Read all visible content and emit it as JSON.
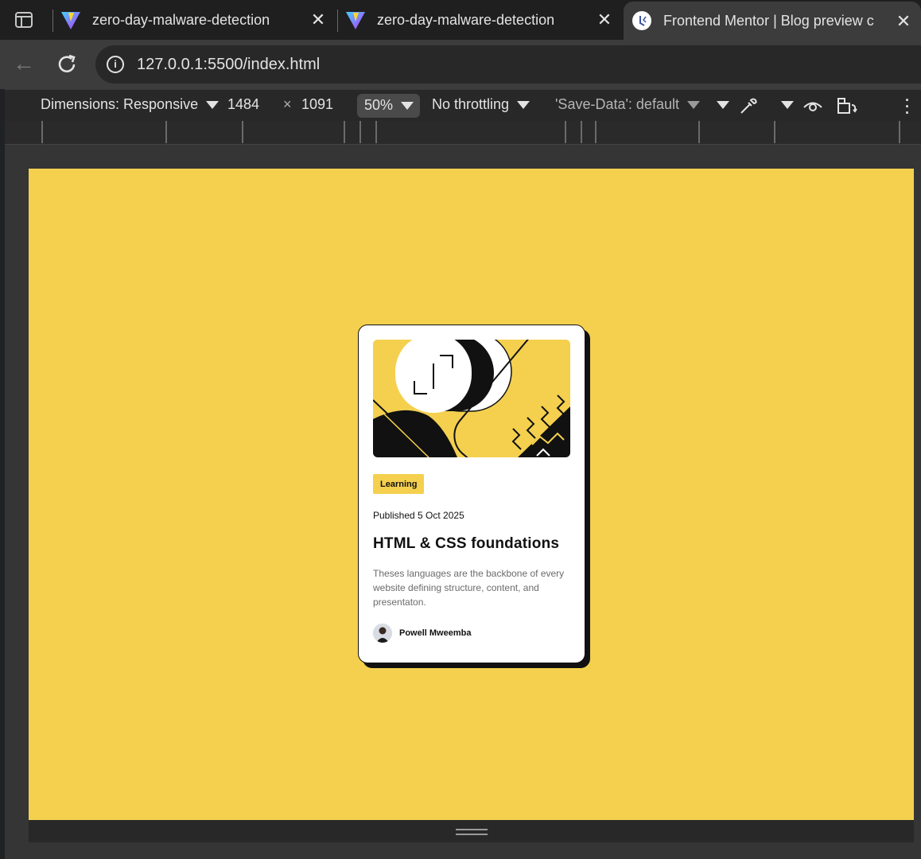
{
  "tabs": [
    {
      "title": "zero-day-malware-detection",
      "favicon": "vite-icon"
    },
    {
      "title": "zero-day-malware-detection",
      "favicon": "vite-icon"
    },
    {
      "title": "Frontend Mentor | Blog preview c",
      "favicon": "frontend-mentor-icon",
      "active": true
    }
  ],
  "address": {
    "url": "127.0.0.1:5500/index.html"
  },
  "device_toolbar": {
    "dimensions_label": "Dimensions: Responsive",
    "width": "1484",
    "times": "×",
    "height": "1091",
    "zoom": "50%",
    "throttling": "No throttling",
    "save_data": "'Save-Data': default"
  },
  "card": {
    "tag": "Learning",
    "published": "Published 5 Oct 2025",
    "title": "HTML & CSS foundations",
    "excerpt": "Theses languages are the backbone of every website defining structure, content, and presentaton.",
    "author": "Powell Mweemba"
  },
  "colors": {
    "page_bg": "#f4d04e",
    "card_bg": "#ffffff",
    "ink": "#111111",
    "chrome_dark": "#1f1f1f",
    "chrome_mid": "#3c3c3c"
  }
}
